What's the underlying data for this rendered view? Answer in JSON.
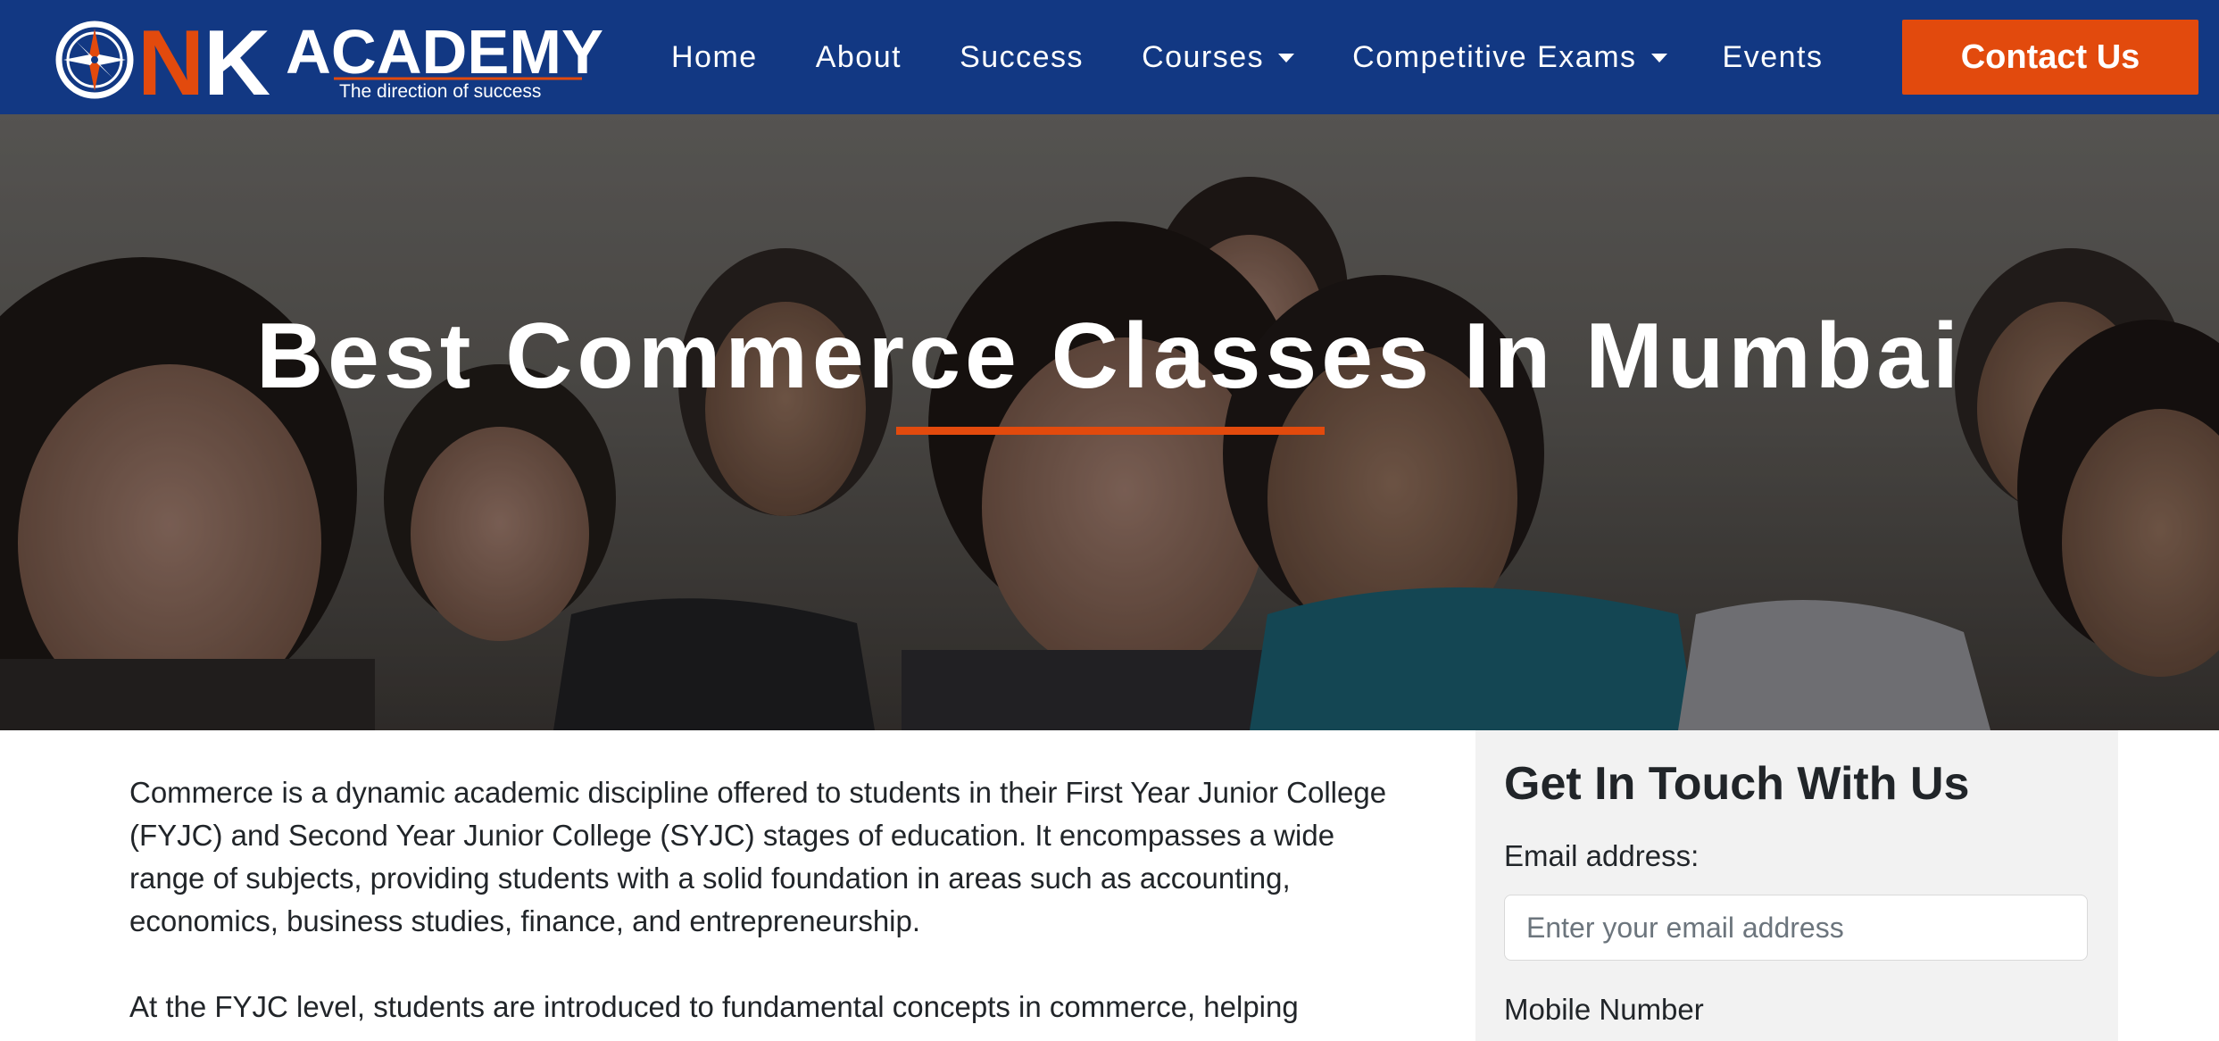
{
  "brand": {
    "letter_n": "N",
    "letter_k": "K",
    "name": "ACADEMY",
    "tagline": "The direction of success",
    "accent_color": "#e24a0d",
    "nav_color": "#123883"
  },
  "nav": {
    "home": "Home",
    "about": "About",
    "success": "Success",
    "courses": "Courses",
    "competitive_exams": "Competitive Exams",
    "events": "Events",
    "contact": "Contact Us"
  },
  "hero": {
    "title": "Best Commerce Classes In Mumbai"
  },
  "content": {
    "paragraphs": [
      "Commerce is a dynamic academic discipline offered to students in their First Year Junior College (FYJC) and Second Year Junior College (SYJC) stages of education. It encompasses a wide range of subjects, providing students with a solid foundation in areas such as accounting, economics, business studies, finance, and entrepreneurship.",
      "At the FYJC level, students are introduced to fundamental concepts in commerce, helping"
    ]
  },
  "form": {
    "title": "Get In Touch With Us",
    "email_label": "Email address:",
    "email_placeholder": "Enter your email address",
    "mobile_label": "Mobile Number"
  }
}
